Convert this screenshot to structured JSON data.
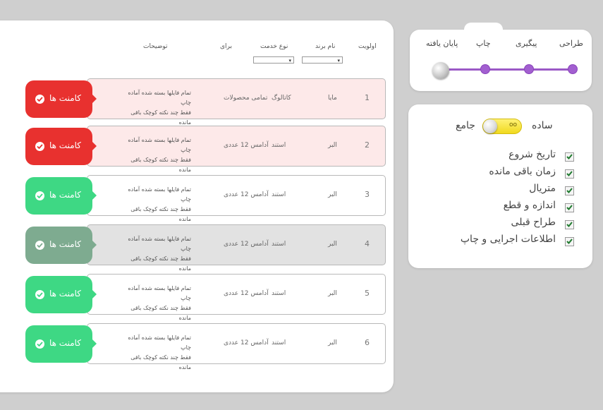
{
  "table": {
    "headers": {
      "priority": "اولویت",
      "brand": "نام برند",
      "service": "نوع خدمت",
      "for": "برای",
      "notes": "توضیحات"
    },
    "rows": [
      {
        "num": "1",
        "brand": "مایا",
        "service": "کاتالوگ",
        "for": "تمامی محصولات",
        "note1": "تمام فایلها بسته شده آماده چاپ",
        "note2": "فقط چند نکته کوچک باقی مانده",
        "comment": "کامنت ها",
        "btn_color": "#e8312f",
        "row_bg": "#fde9e9"
      },
      {
        "num": "2",
        "brand": "البر",
        "service": "استند",
        "for": "آدامس 12 عددی",
        "note1": "تمام فایلها بسته شده آماده چاپ",
        "note2": "فقط چند نکته کوچک باقی مانده",
        "comment": "کامنت ها",
        "btn_color": "#e8312f",
        "row_bg": "#fde9e9"
      },
      {
        "num": "3",
        "brand": "البر",
        "service": "استند",
        "for": "آدامس 12 عددی",
        "note1": "تمام فایلها بسته شده آماده چاپ",
        "note2": "فقط چند نکته کوچک باقی مانده",
        "comment": "کامنت ها",
        "btn_color": "#3ed884",
        "row_bg": "#ffffff"
      },
      {
        "num": "4",
        "brand": "البر",
        "service": "استند",
        "for": "آدامس 12 عددی",
        "note1": "تمام فایلها بسته شده آماده چاپ",
        "note2": "فقط چند نکته کوچک باقی مانده",
        "comment": "کامنت ها",
        "btn_color": "#7eab90",
        "row_bg": "#e2e2e2"
      },
      {
        "num": "5",
        "brand": "البر",
        "service": "استند",
        "for": "آدامس 12 عددی",
        "note1": "تمام فایلها بسته شده آماده چاپ",
        "note2": "فقط چند نکته کوچک باقی مانده",
        "comment": "کامنت ها",
        "btn_color": "#3ed884",
        "row_bg": "#ffffff"
      },
      {
        "num": "6",
        "brand": "البر",
        "service": "استند",
        "for": "آدامس 12 عددی",
        "note1": "تمام فایلها بسته شده آماده چاپ",
        "note2": "فقط چند نکته کوچک باقی مانده",
        "comment": "کامنت ها",
        "btn_color": "#3ed884",
        "row_bg": "#ffffff"
      }
    ]
  },
  "stages": {
    "labels": [
      "طراحی",
      "پیگیری",
      "چاپ",
      "پایان یافته"
    ],
    "active": "چاپ",
    "track_color": "#9b59c6"
  },
  "view": {
    "simple": "ساده",
    "full": "جامع",
    "toggle_text": "oo",
    "toggle_color": "#f0d81a"
  },
  "options": [
    "تاریخ شروع",
    "زمان باقی مانده",
    "متریال",
    "اندازه و قطع",
    "طراح قبلی",
    "اطلاعات اجرایی و چاپ"
  ],
  "icons": {
    "comment_button": "check-circle-icon",
    "option_checkbox": "check-icon",
    "select_arrow": "chevron-down-icon"
  }
}
